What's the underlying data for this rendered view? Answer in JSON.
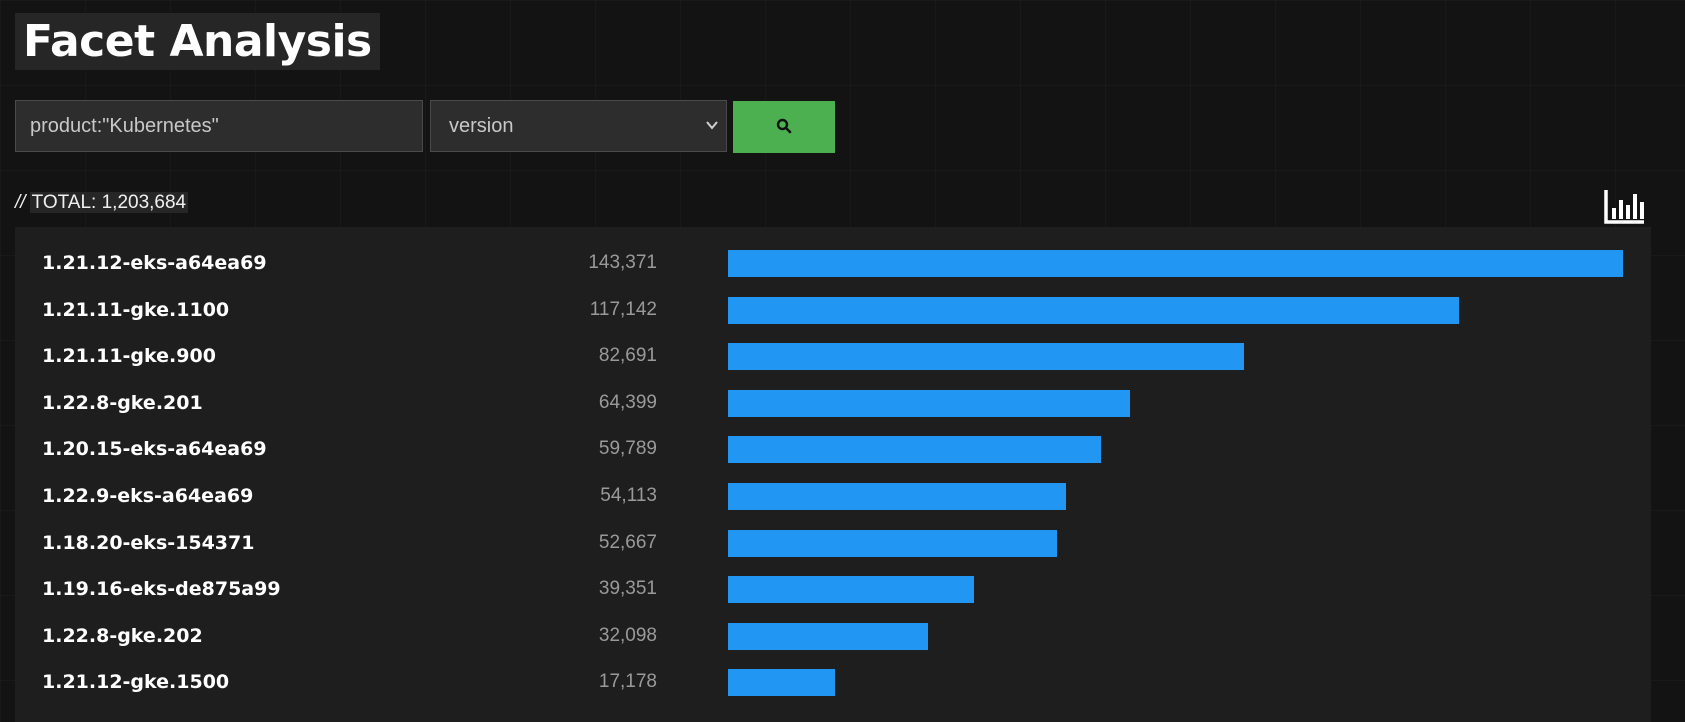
{
  "page": {
    "title": "Facet Analysis"
  },
  "search": {
    "query_value": "product:\"Kubernetes\"",
    "facet_selected": "version",
    "button_icon": "search-icon"
  },
  "summary": {
    "total_text": "TOTAL: 1,203,684",
    "slashes": "//",
    "chart_toggle_icon": "bar-chart-icon"
  },
  "colors": {
    "bar": "#2196f3",
    "search_button": "#4caf50"
  },
  "chart_data": {
    "type": "bar",
    "orientation": "horizontal",
    "categories": [
      "1.21.12-eks-a64ea69",
      "1.21.11-gke.1100",
      "1.21.11-gke.900",
      "1.22.8-gke.201",
      "1.20.15-eks-a64ea69",
      "1.22.9-eks-a64ea69",
      "1.18.20-eks-154371",
      "1.19.16-eks-de875a99",
      "1.22.8-gke.202",
      "1.21.12-gke.1500"
    ],
    "values": [
      143371,
      117142,
      82691,
      64399,
      59789,
      54113,
      52667,
      39351,
      32098,
      17178
    ],
    "value_labels": [
      "143,371",
      "117,142",
      "82,691",
      "64,399",
      "59,789",
      "54,113",
      "52,667",
      "39,351",
      "32,098",
      "17,178"
    ],
    "xlim": [
      0,
      143371
    ],
    "grid": false
  }
}
